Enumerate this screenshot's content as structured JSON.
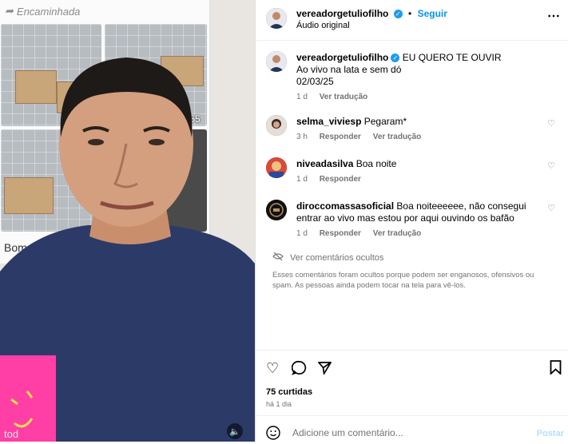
{
  "media": {
    "forwarded_label": "Encaminhada",
    "video_time": ":55",
    "caption_partial": "Bom",
    "bottom_partial": "tod"
  },
  "header": {
    "username": "vereadorgetuliofilho",
    "follow_label": "Seguir",
    "audio_label": "Áudio original",
    "more_icon": "more-horizontal-icon"
  },
  "caption": {
    "username": "vereadorgetuliofilho",
    "text_line1": "EU QUERO TE OUVIR",
    "text_line2": "Ao vivo na lata e sem dó",
    "text_line3": "02/03/25",
    "time": "1 d",
    "translate_label": "Ver tradução"
  },
  "comments": [
    {
      "username": "selma_viviesp",
      "text": "Pegaram*",
      "time": "3 h",
      "reply_label": "Responder",
      "translate_label": "Ver tradução"
    },
    {
      "username": "niveadasilva",
      "text": "Boa noite",
      "time": "1 d",
      "reply_label": "Responder"
    },
    {
      "username": "diroccomassasoficial",
      "text": "Boa noiteeeeee, não consegui entrar ao vivo mas estou por aqui ouvindo os bafão",
      "time": "1 d",
      "reply_label": "Responder",
      "translate_label": "Ver tradução"
    }
  ],
  "hidden": {
    "link_label": "Ver comentários ocultos",
    "note": "Esses comentários foram ocultos porque podem ser enganosos, ofensivos ou spam. As pessoas ainda podem tocar na tela para vê-los."
  },
  "stats": {
    "likes": "75 curtidas",
    "ago": "há 1 dia"
  },
  "composer": {
    "placeholder": "Adicione um comentário...",
    "post_label": "Postar"
  },
  "colors": {
    "accent": "#0095f6",
    "muted": "#737373",
    "shirt": "#2c3a68"
  }
}
